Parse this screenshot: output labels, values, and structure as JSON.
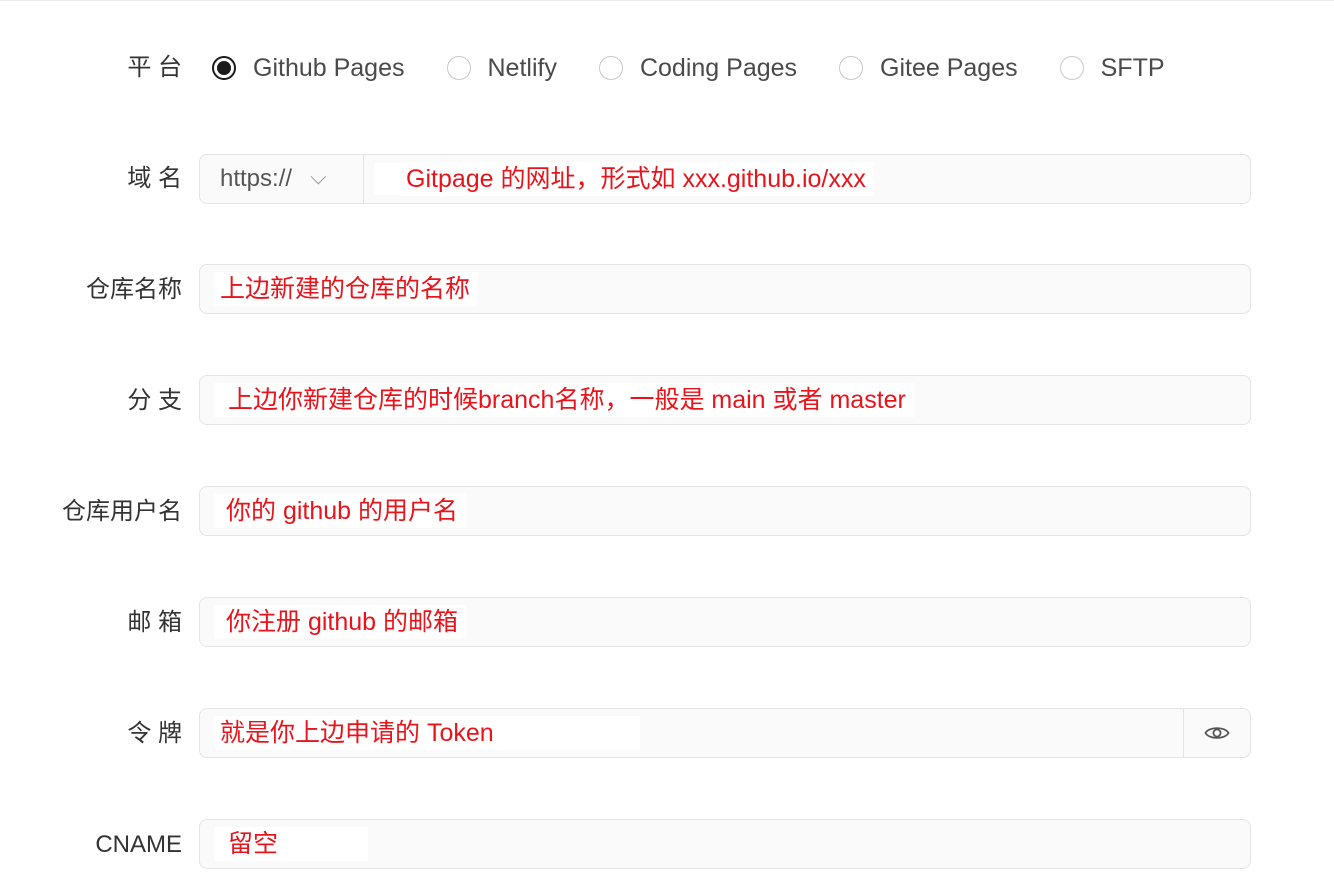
{
  "platform": {
    "label": "平 台",
    "options": [
      {
        "label": "Github Pages",
        "checked": true
      },
      {
        "label": "Netlify",
        "checked": false
      },
      {
        "label": "Coding Pages",
        "checked": false
      },
      {
        "label": "Gitee Pages",
        "checked": false
      },
      {
        "label": "SFTP",
        "checked": false
      }
    ]
  },
  "domain": {
    "label": "域 名",
    "protocol": "https://",
    "value": "Gitpage 的网址，形式如 xxx.github.io/xxx"
  },
  "repo_name": {
    "label": "仓库名称",
    "value": "上边新建的仓库的名称"
  },
  "branch": {
    "label": "分 支",
    "value": "上边你新建仓库的时候branch名称，一般是 main 或者 master"
  },
  "repo_user": {
    "label": "仓库用户名",
    "value": "你的 github 的用户名"
  },
  "email": {
    "label": "邮 箱",
    "value": "你注册 github 的邮箱"
  },
  "token": {
    "label": "令 牌",
    "value": "就是你上边申请的 Token",
    "toggle_icon": "eye-icon"
  },
  "cname": {
    "label": "CNAME",
    "value": "留空"
  },
  "colors": {
    "annotation": "#e8141c",
    "field_bg": "#fafafa",
    "field_border": "#e4e4e4"
  }
}
